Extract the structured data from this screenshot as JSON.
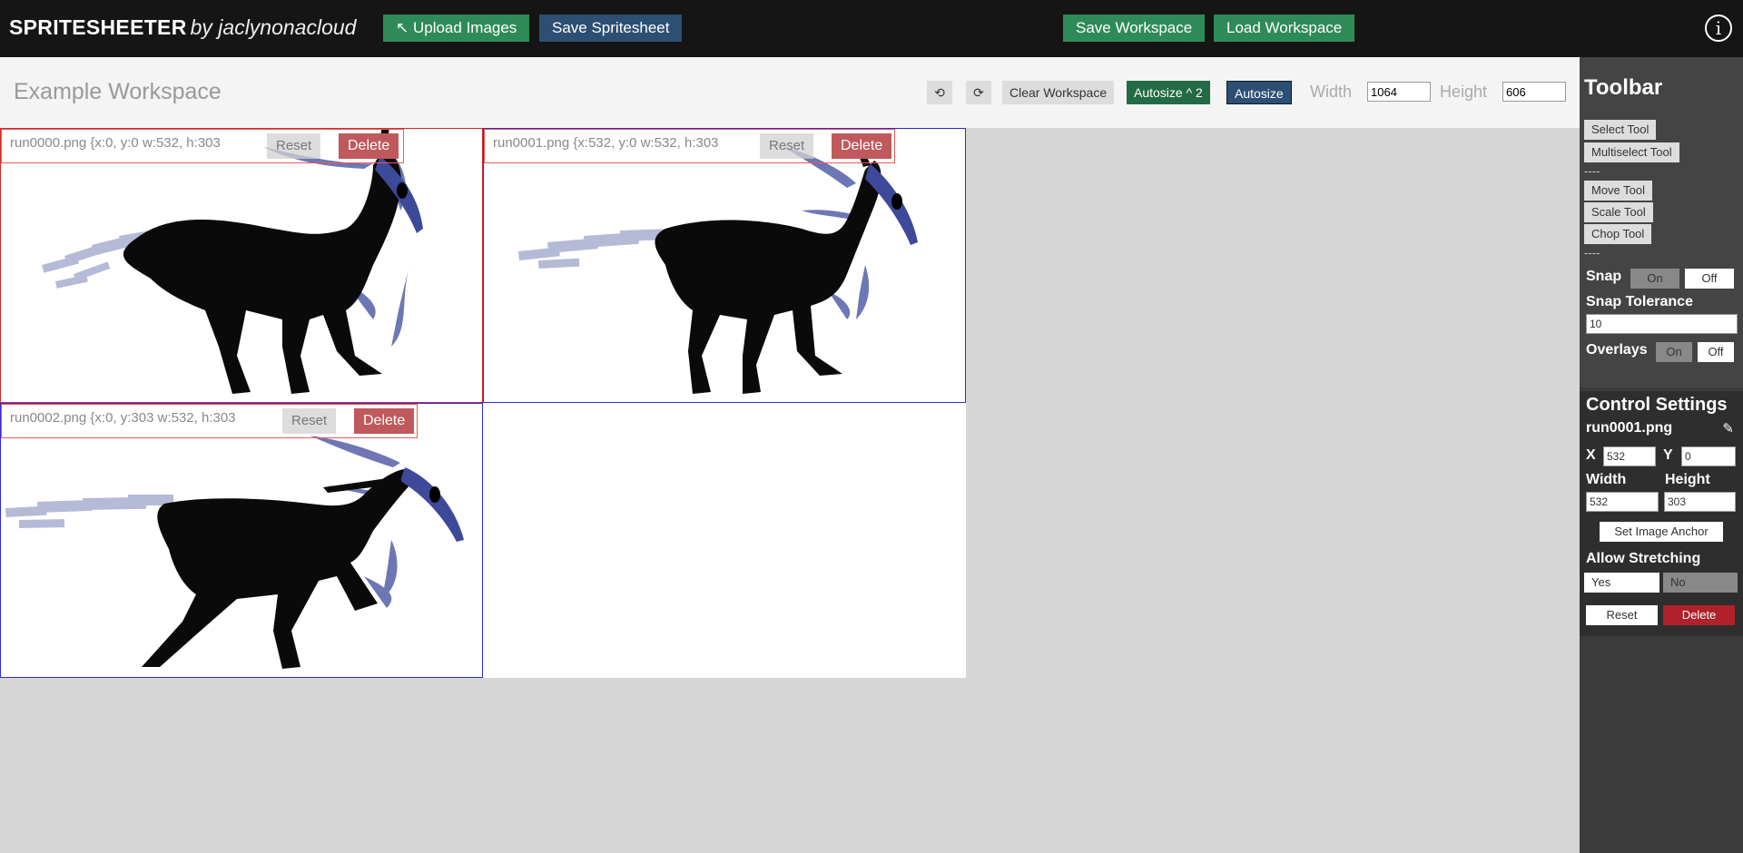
{
  "app": {
    "brand_name": "SPRITESHEETER",
    "brand_by": "by jaclynonacloud"
  },
  "topbar": {
    "upload_label": "↖ Upload Images",
    "save_spritesheet_label": "Save Spritesheet",
    "save_workspace_label": "Save Workspace",
    "load_workspace_label": "Load Workspace",
    "info_glyph": "i"
  },
  "workspace": {
    "title": "Example Workspace",
    "undo_glyph": "⟲",
    "redo_glyph": "⟳",
    "clear_label": "Clear Workspace",
    "autosize_pow2_label": "Autosize ^ 2",
    "autosize_label": "Autosize",
    "width_label": "Width",
    "width_value": "1064",
    "height_label": "Height",
    "height_value": "606"
  },
  "sprites": [
    {
      "label": "run0000.png {x:0, y:0  w:532, h:303",
      "reset": "Reset",
      "delete": "Delete"
    },
    {
      "label": "run0001.png {x:532, y:0  w:532, h:303",
      "reset": "Reset",
      "delete": "Delete"
    },
    {
      "label": "run0002.png {x:0, y:303  w:532, h:303",
      "reset": "Reset",
      "delete": "Delete"
    }
  ],
  "toolbar": {
    "title": "Toolbar",
    "select_tool": "Select Tool",
    "multiselect_tool": "Multiselect Tool",
    "divider1": "----",
    "move_tool": "Move Tool",
    "scale_tool": "Scale Tool",
    "chop_tool": "Chop Tool",
    "divider2": "----",
    "snap_label": "Snap",
    "snap_on": "On",
    "snap_off": "Off",
    "snap_tolerance_label": "Snap Tolerance",
    "snap_tolerance_value": "10",
    "overlays_label": "Overlays",
    "overlays_on": "On",
    "overlays_off": "Off"
  },
  "control": {
    "title": "Control Settings",
    "filename": "run0001.png",
    "x_label": "X",
    "x_value": "532",
    "y_label": "Y",
    "y_value": "0",
    "width_label": "Width",
    "width_value": "532",
    "height_label": "Height",
    "height_value": "303",
    "anchor_label": "Set Image Anchor",
    "stretch_label": "Allow Stretching",
    "stretch_yes": "Yes",
    "stretch_no": "No",
    "reset_label": "Reset",
    "delete_label": "Delete"
  },
  "colors": {
    "topbar_bg": "#151515",
    "green_button": "#2e8b57",
    "blue_button": "#2c4f73",
    "selection_red": "#d42b2b",
    "selection_blue": "#2a2add",
    "delete_red": "#b0212b",
    "creature_black": "#0a0a0a",
    "creature_accent": "#3d4a9a"
  }
}
